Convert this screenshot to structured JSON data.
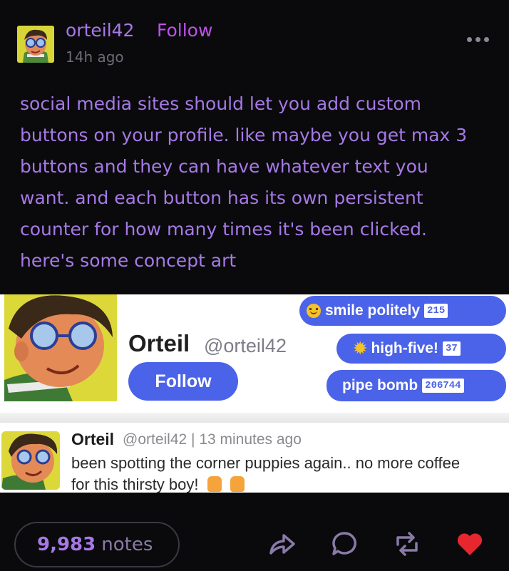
{
  "post": {
    "username": "orteil42",
    "follow_label": "Follow",
    "timestamp": "14h ago",
    "text": "social media sites should let you add custom buttons on your profile. like maybe you get max 3 buttons and they can have whatever text you want. and each button has its own persistent counter for how many times it's been clicked. here's some concept art"
  },
  "concept": {
    "display_name": "Orteil",
    "handle": "@orteil42",
    "follow_button": "Follow",
    "custom_buttons": [
      {
        "icon": "smile-emoji",
        "label": "smile politely",
        "count": "215"
      },
      {
        "icon": "sparkle-emoji",
        "label": "high-five!",
        "count": "37"
      },
      {
        "icon": "",
        "label": "pipe bomb",
        "count": "206744"
      }
    ],
    "tweet": {
      "name": "Orteil",
      "handle_time": "@orteil42 | 13 minutes ago",
      "text_line1": "been spotting the corner puppies again.. no more coffee",
      "text_line2": "for this thirsty boy!",
      "emojis": [
        "thumbs-up-icon",
        "thumbs-up-icon"
      ]
    }
  },
  "footer": {
    "notes_count": "9,983",
    "notes_label": "notes",
    "actions": [
      "share-icon",
      "reply-icon",
      "reblog-icon",
      "like-heart-icon"
    ],
    "like_color": "#e8262e"
  },
  "colors": {
    "accent_text": "#a679e6",
    "follow_link": "#c050ea",
    "button_blue": "#4b63e8",
    "background": "#0a0a0c"
  }
}
